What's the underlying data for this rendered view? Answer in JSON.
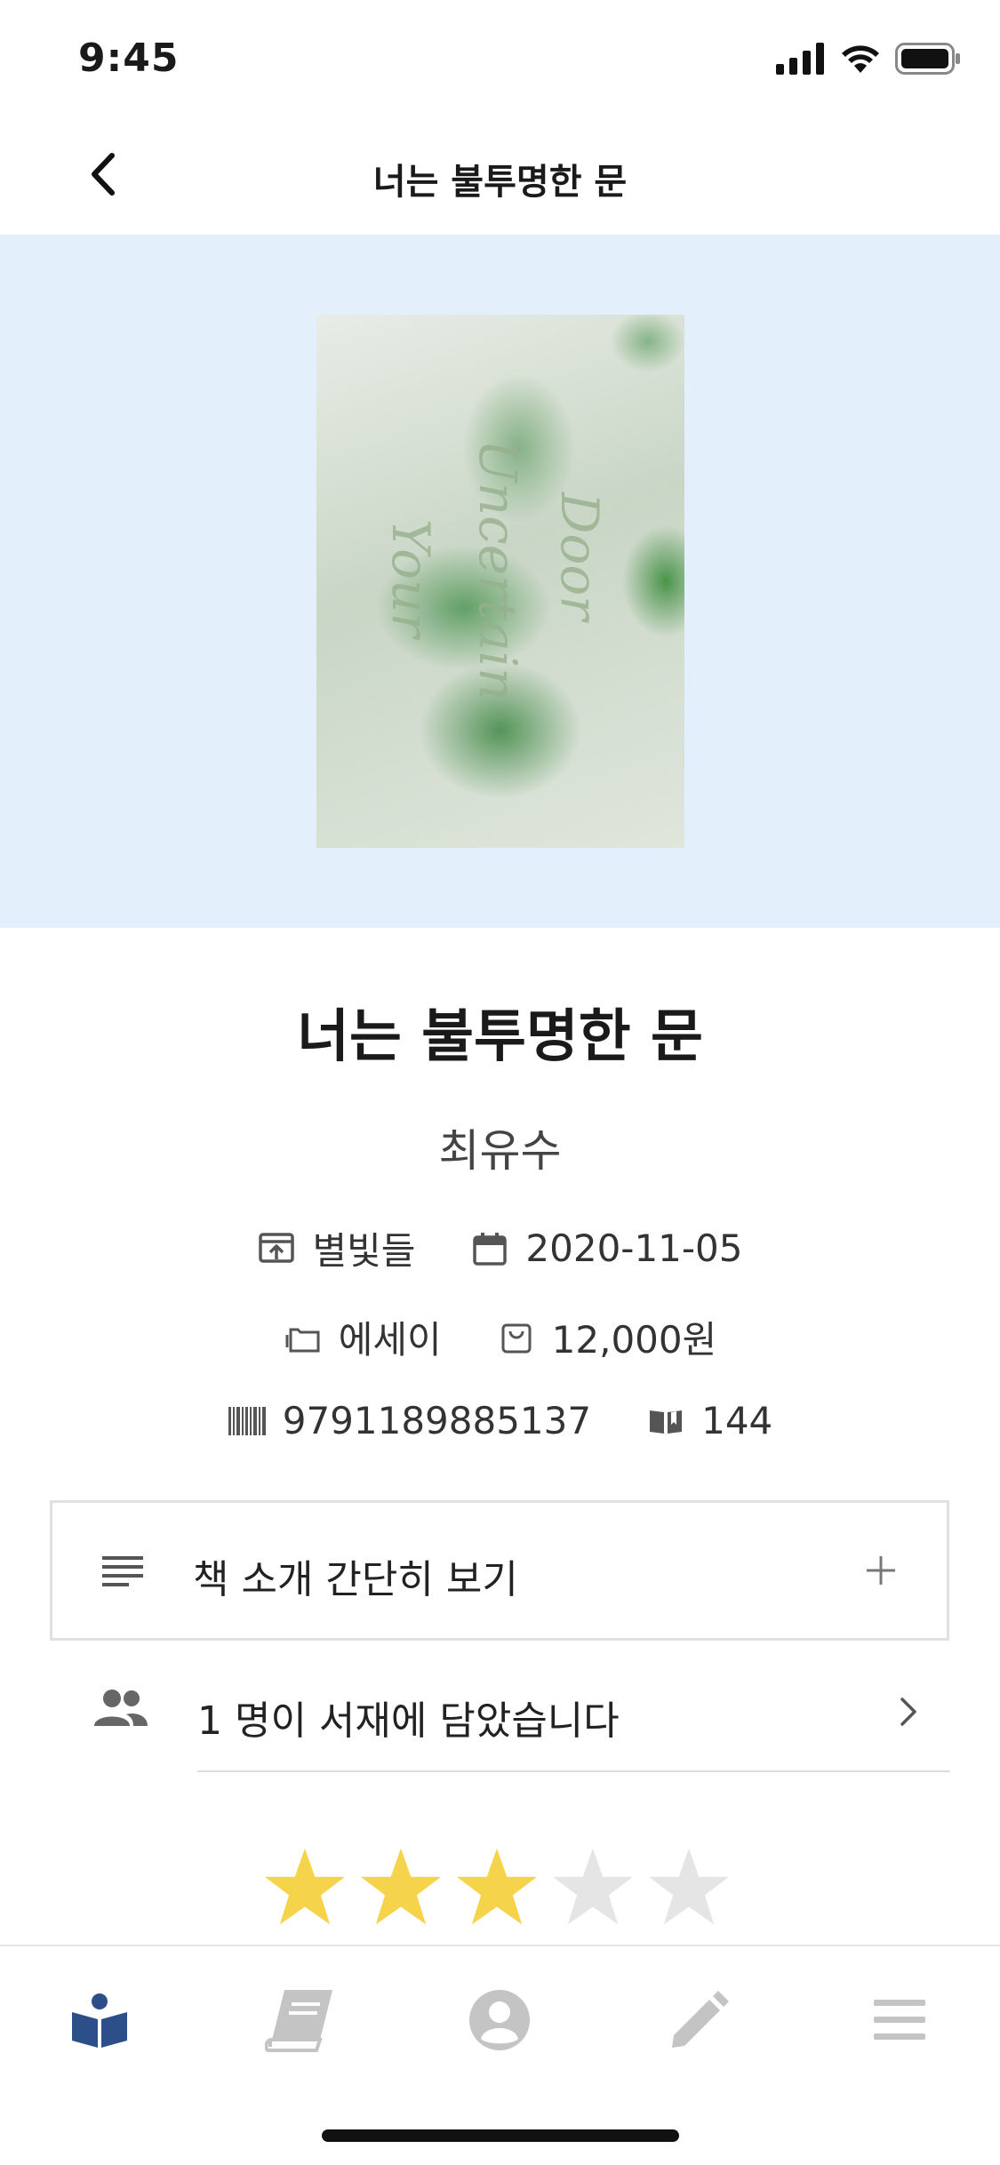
{
  "status_bar": {
    "time": "9:45"
  },
  "nav": {
    "title": "너는 불투명한 문"
  },
  "book": {
    "cover_texts": [
      "Your",
      "Uncertain",
      "Door"
    ],
    "title": "너는 불투명한 문",
    "author": "최유수",
    "publisher": "별빛들",
    "date": "2020-11-05",
    "category": "에세이",
    "price": "12,000원",
    "isbn": "9791189885137",
    "pages": "144"
  },
  "intro": {
    "label": "책 소개 간단히 보기"
  },
  "shelf": {
    "label": "1 명이 서재에 담았습니다"
  },
  "rating": {
    "value": 3,
    "max": 5
  },
  "colors": {
    "accent": "#2c4f8a",
    "hero_bg": "#e3f0fb",
    "star_on": "#f5d34a",
    "star_off": "#e5e5e5",
    "icon_gray": "#c4c4c4"
  },
  "tabs": [
    {
      "icon": "reading-book-icon",
      "active": true
    },
    {
      "icon": "book-icon",
      "active": false
    },
    {
      "icon": "user-icon",
      "active": false
    },
    {
      "icon": "pencil-icon",
      "active": false
    },
    {
      "icon": "menu-icon",
      "active": false
    }
  ]
}
